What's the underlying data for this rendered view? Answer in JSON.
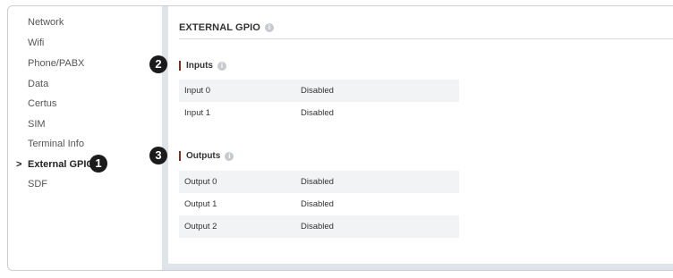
{
  "sidebar": {
    "items": [
      {
        "label": "Network"
      },
      {
        "label": "Wifi"
      },
      {
        "label": "Phone/PABX"
      },
      {
        "label": "Data"
      },
      {
        "label": "Certus"
      },
      {
        "label": "SIM"
      },
      {
        "label": "Terminal Info"
      },
      {
        "label": "External GPIO",
        "active": true
      },
      {
        "label": "SDF"
      }
    ],
    "active_marker": ">"
  },
  "page": {
    "title": "EXTERNAL GPIO",
    "info_glyph": "i"
  },
  "inputs": {
    "label": "Inputs",
    "rows": [
      {
        "name": "Input 0",
        "value": "Disabled"
      },
      {
        "name": "Input 1",
        "value": "Disabled"
      }
    ]
  },
  "outputs": {
    "label": "Outputs",
    "rows": [
      {
        "name": "Output 0",
        "value": "Disabled"
      },
      {
        "name": "Output 1",
        "value": "Disabled"
      },
      {
        "name": "Output 2",
        "value": "Disabled"
      }
    ]
  },
  "callouts": {
    "one": "1",
    "two": "2",
    "three": "3"
  },
  "colors": {
    "section_bar": "#8a2d1e",
    "gutter": "#dfe3ea",
    "badge": "#1b1b1b"
  }
}
